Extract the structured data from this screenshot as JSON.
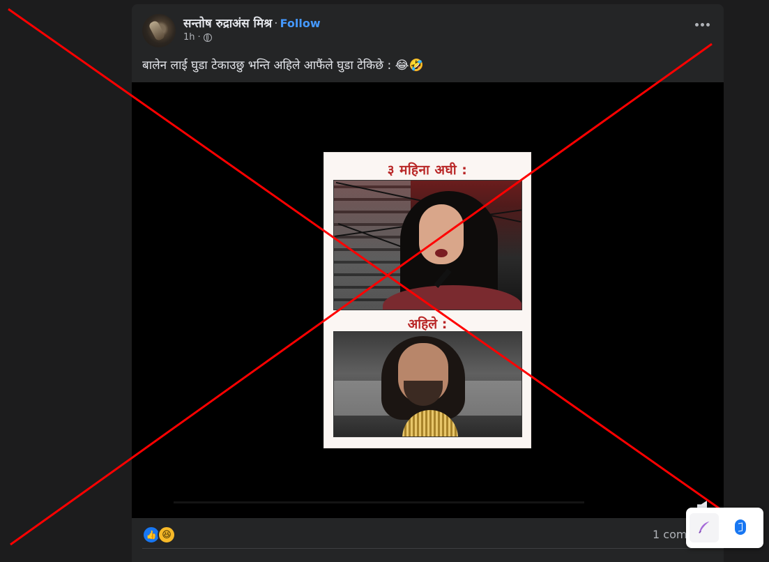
{
  "post": {
    "author": "सन्तोष रुद्राअंस मिश्र",
    "separator": "·",
    "follow_label": "Follow",
    "time": "1h",
    "caption": "बालेन लाई घुडा टेकाउछु भन्ति अहिले आफैंले घुडा टेकिछे : 😂🤣",
    "comments_text": "1 com"
  },
  "video": {
    "thumbnail_top_text": "३ महिना अघी :",
    "thumbnail_mid_text": "अहिले :"
  },
  "icons": {
    "globe": "globe-icon",
    "more": "more-options-icon",
    "like": "like-reaction-icon",
    "haha": "haha-reaction-icon",
    "mute": "volume-muted-icon",
    "quill": "quill-icon",
    "bluetooth": "bluetooth-icon"
  },
  "colors": {
    "background": "#1c1c1d",
    "card": "#242526",
    "follow": "#4599ff",
    "overlay_x": "#ff0000",
    "like_blue": "#1877f2",
    "haha_yellow": "#f7b928"
  },
  "overlay": {
    "type": "red-x-cross-out"
  }
}
